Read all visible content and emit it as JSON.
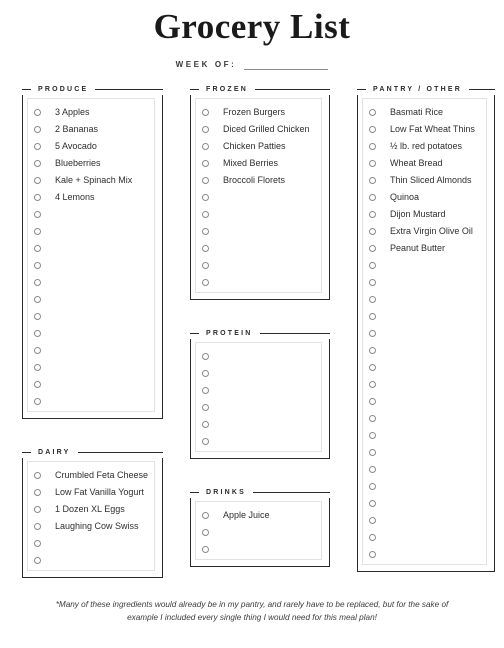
{
  "header": {
    "title": "Grocery List",
    "week_label": "WEEK OF:"
  },
  "columns": [
    {
      "name": "column-left",
      "sections": [
        {
          "id": "produce",
          "title": "PRODUCE",
          "items": [
            "3 Apples",
            "2 Bananas",
            "5 Avocado",
            "Blueberries",
            "Kale + Spinach Mix",
            "4 Lemons"
          ],
          "blank_rows": 12
        },
        {
          "id": "dairy",
          "title": "DAIRY",
          "items": [
            "Crumbled Feta Cheese",
            "Low Fat Vanilla Yogurt",
            "1 Dozen XL Eggs",
            "Laughing Cow Swiss"
          ],
          "blank_rows": 2
        }
      ]
    },
    {
      "name": "column-middle",
      "sections": [
        {
          "id": "frozen",
          "title": "FROZEN",
          "items": [
            "Frozen Burgers",
            "Diced Grilled Chicken",
            "Chicken Patties",
            "Mixed Berries",
            "Broccoli Florets"
          ],
          "blank_rows": 6
        },
        {
          "id": "protein",
          "title": "PROTEIN",
          "items": [],
          "blank_rows": 6
        },
        {
          "id": "drinks",
          "title": "DRINKS",
          "items": [
            "Apple Juice"
          ],
          "blank_rows": 2
        }
      ]
    },
    {
      "name": "column-right",
      "sections": [
        {
          "id": "pantry-other",
          "title": "PANTRY / OTHER",
          "items": [
            "Basmati Rice",
            "Low Fat Wheat Thins",
            "½ lb. red potatoes",
            "Wheat Bread",
            "Thin Sliced Almonds",
            "Quinoa",
            "Dijon Mustard",
            "Extra Virgin Olive Oil",
            "Peanut Butter"
          ],
          "blank_rows": 18
        }
      ]
    }
  ],
  "footnote": "*Many of these ingredients would already be in my pantry, and rarely have to be replaced, but for the sake of example I included every single thing I would need for this meal plan!"
}
